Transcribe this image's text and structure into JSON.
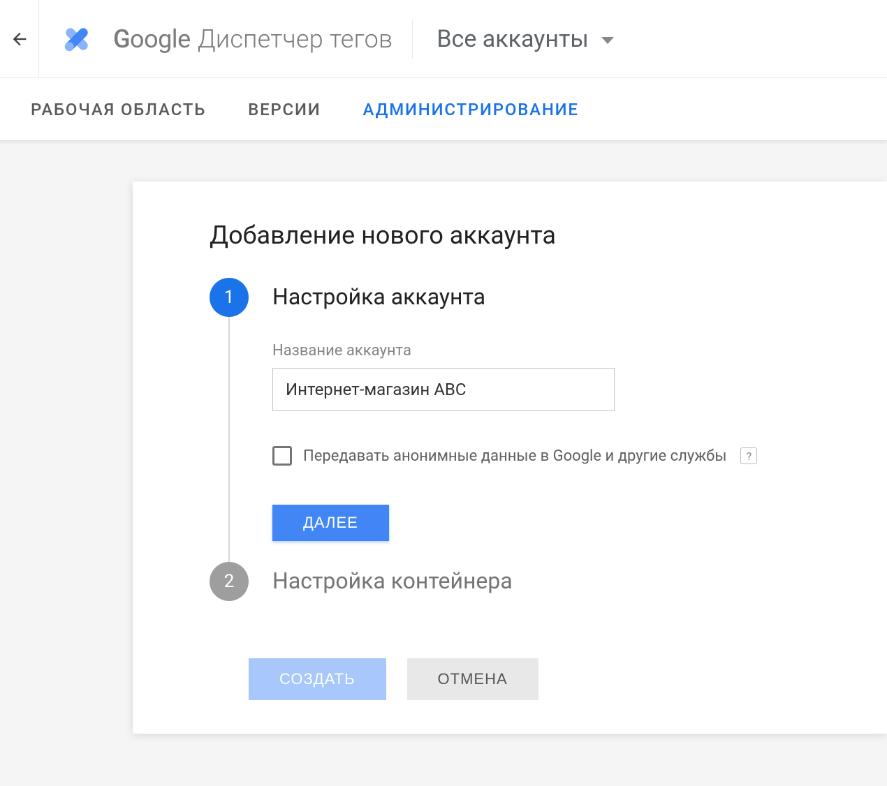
{
  "header": {
    "brand_google": "Google",
    "brand_product": "Диспетчер тегов",
    "account_selector": "Все аккаунты"
  },
  "tabs": {
    "workspace": "РАБОЧАЯ ОБЛАСТЬ",
    "versions": "ВЕРСИИ",
    "admin": "АДМИНИСТРИРОВАНИЕ"
  },
  "card": {
    "title": "Добавление нового аккаунта"
  },
  "step1": {
    "num": "1",
    "title": "Настройка аккаунта",
    "field_label": "Название аккаунта",
    "field_value": "Интернет-магазин ABC",
    "checkbox_label": "Передавать анонимные данные в Google и другие службы",
    "help": "?",
    "next_btn": "ДАЛЕЕ"
  },
  "step2": {
    "num": "2",
    "title": "Настройка контейнера"
  },
  "footer": {
    "create": "СОЗДАТЬ",
    "cancel": "ОТМЕНА"
  }
}
